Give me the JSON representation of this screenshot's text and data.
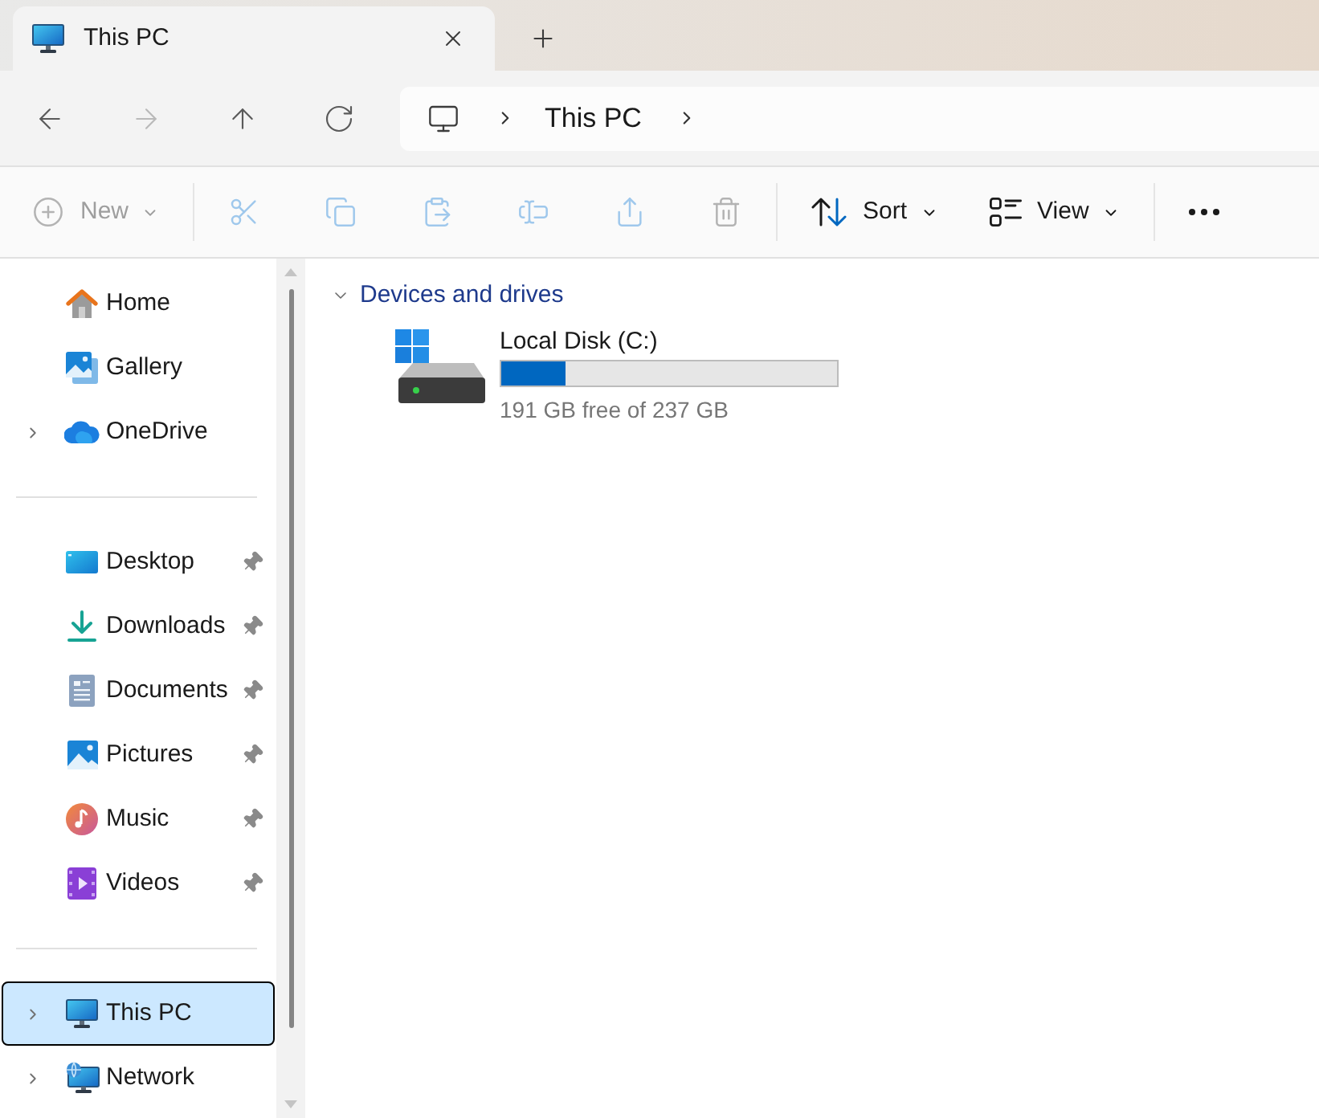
{
  "tabs": [
    {
      "title": "This PC",
      "selected": true
    }
  ],
  "navigation": [
    {
      "kind": "back",
      "disabled": false
    },
    {
      "kind": "forward",
      "disabled": true
    },
    {
      "kind": "up",
      "disabled": false
    },
    {
      "kind": "refresh",
      "disabled": false
    }
  ],
  "address_bar": {
    "segments": [
      "This PC"
    ]
  },
  "command_bar": {
    "groups": [
      [
        {
          "kind": "new",
          "label": "New",
          "dropdown": true,
          "disabled": true
        }
      ],
      [
        {
          "kind": "cut",
          "dropdown": false,
          "disabled": true
        },
        {
          "kind": "copy",
          "dropdown": false,
          "disabled": true
        },
        {
          "kind": "paste",
          "dropdown": false,
          "disabled": true
        },
        {
          "kind": "rename",
          "dropdown": false,
          "disabled": true
        },
        {
          "kind": "share",
          "dropdown": false,
          "disabled": true
        },
        {
          "kind": "delete",
          "dropdown": false,
          "disabled": true
        }
      ],
      [
        {
          "kind": "sort",
          "label": "Sort",
          "dropdown": true,
          "disabled": false
        },
        {
          "kind": "view",
          "label": "View",
          "dropdown": true,
          "disabled": false
        }
      ],
      [
        {
          "kind": "more",
          "dropdown": false,
          "disabled": false
        }
      ]
    ]
  },
  "sidebar": {
    "sections": [
      {
        "items": [
          {
            "kind": "home",
            "label": "Home",
            "expandable": false,
            "pinned": false,
            "selected": false
          },
          {
            "kind": "gallery",
            "label": "Gallery",
            "expandable": false,
            "pinned": false,
            "selected": false
          },
          {
            "kind": "onedrive",
            "label": "OneDrive",
            "expandable": true,
            "pinned": false,
            "selected": false
          }
        ]
      },
      {
        "items": [
          {
            "kind": "desktop",
            "label": "Desktop",
            "expandable": false,
            "pinned": true,
            "selected": false
          },
          {
            "kind": "downloads",
            "label": "Downloads",
            "expandable": false,
            "pinned": true,
            "selected": false
          },
          {
            "kind": "documents",
            "label": "Documents",
            "expandable": false,
            "pinned": true,
            "selected": false
          },
          {
            "kind": "pictures",
            "label": "Pictures",
            "expandable": false,
            "pinned": true,
            "selected": false
          },
          {
            "kind": "music",
            "label": "Music",
            "expandable": false,
            "pinned": true,
            "selected": false
          },
          {
            "kind": "videos",
            "label": "Videos",
            "expandable": false,
            "pinned": true,
            "selected": false
          }
        ]
      },
      {
        "items": [
          {
            "kind": "this_pc",
            "label": "This PC",
            "expandable": true,
            "pinned": false,
            "selected": true
          },
          {
            "kind": "network",
            "label": "Network",
            "expandable": true,
            "pinned": false,
            "selected": false
          }
        ]
      }
    ]
  },
  "content": {
    "groups": [
      {
        "title": "Devices and drives",
        "expanded": true,
        "drives": [
          {
            "name": "Local Disk (C:)",
            "level": 0.19,
            "space": "191 GB free of 237 GB"
          }
        ]
      }
    ]
  }
}
